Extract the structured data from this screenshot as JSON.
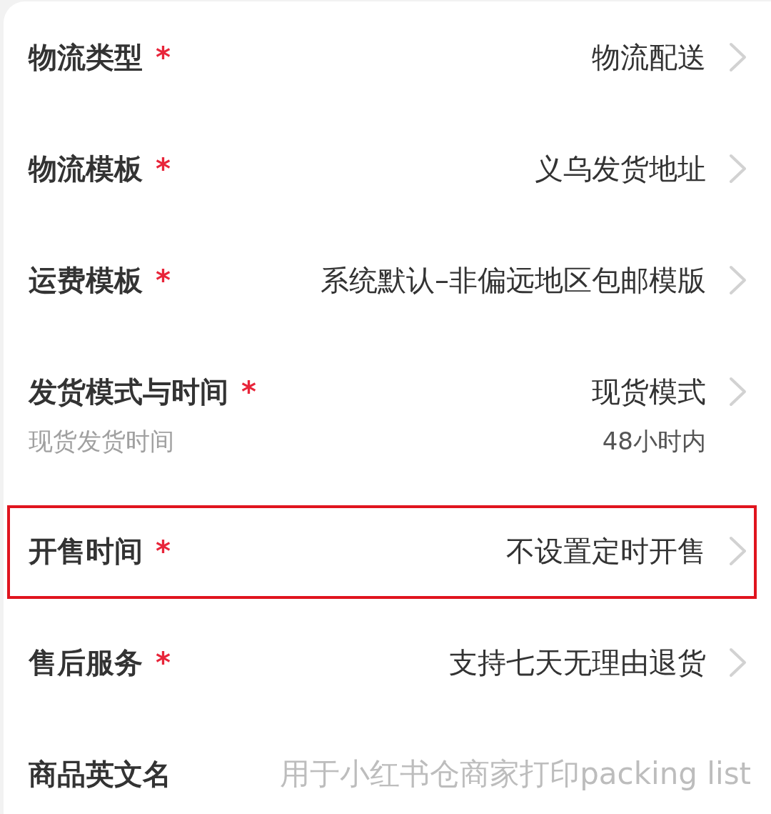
{
  "required_mark": "*",
  "rows": [
    {
      "kind": "select",
      "label": "物流类型",
      "required": true,
      "value": "物流配送",
      "highlighted": false
    },
    {
      "kind": "select",
      "label": "物流模板",
      "required": true,
      "value": "义乌发货地址",
      "highlighted": false
    },
    {
      "kind": "select",
      "label": "运费模板",
      "required": true,
      "value": "系统默认–非偏远地区包邮模版",
      "highlighted": false
    },
    {
      "kind": "select",
      "label": "发货模式与时间",
      "required": true,
      "value": "现货模式",
      "sub_label": "现货发货时间",
      "sub_value": "48小时内",
      "highlighted": false
    },
    {
      "kind": "select",
      "label": "开售时间",
      "required": true,
      "value": "不设置定时开售",
      "highlighted": true
    },
    {
      "kind": "select",
      "label": "售后服务",
      "required": true,
      "value": "支持七天无理由退货",
      "highlighted": false
    },
    {
      "kind": "input",
      "label": "商品英文名",
      "required": false,
      "placeholder": "用于小红书仓商家打印packing list",
      "highlighted": false
    }
  ]
}
